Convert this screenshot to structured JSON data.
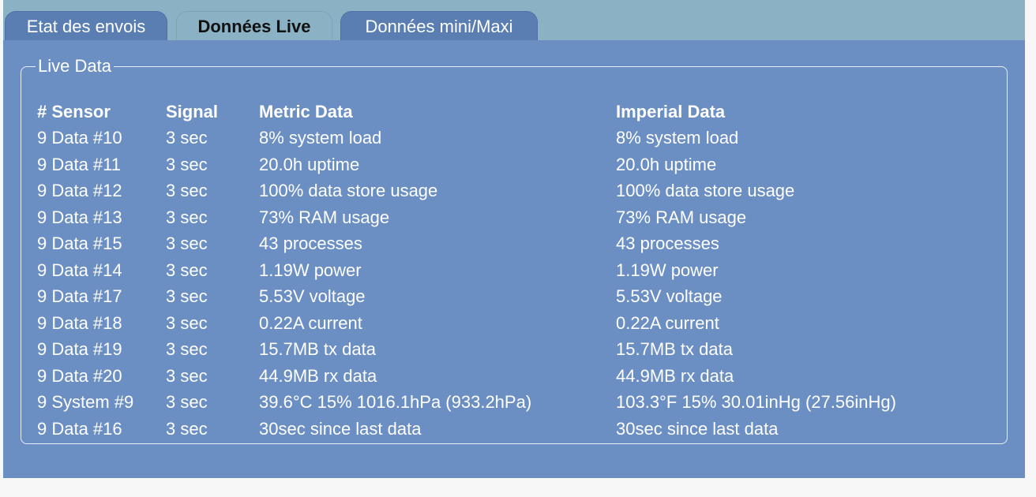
{
  "tabs": [
    {
      "label": "Etat des envois",
      "active": false
    },
    {
      "label": "Données Live",
      "active": true
    },
    {
      "label": "Données mini/Maxi",
      "active": false
    }
  ],
  "panel": {
    "legend": "Live Data",
    "headers": [
      "# Sensor",
      "Signal",
      "Metric Data",
      "Imperial Data"
    ],
    "rows": [
      [
        "9 Data #10",
        "3 sec",
        "8% system load",
        "8% system load"
      ],
      [
        "9 Data #11",
        "3 sec",
        "20.0h uptime",
        "20.0h uptime"
      ],
      [
        "9 Data #12",
        "3 sec",
        "100% data store usage",
        "100% data store usage"
      ],
      [
        "9 Data #13",
        "3 sec",
        "73% RAM usage",
        "73% RAM usage"
      ],
      [
        "9 Data #15",
        "3 sec",
        "43 processes",
        "43 processes"
      ],
      [
        "9 Data #14",
        "3 sec",
        "1.19W power",
        "1.19W power"
      ],
      [
        "9 Data #17",
        "3 sec",
        "5.53V voltage",
        "5.53V voltage"
      ],
      [
        "9 Data #18",
        "3 sec",
        "0.22A current",
        "0.22A current"
      ],
      [
        "9 Data #19",
        "3 sec",
        "15.7MB tx data",
        "15.7MB tx data"
      ],
      [
        "9 Data #20",
        "3 sec",
        "44.9MB rx data",
        "44.9MB rx data"
      ],
      [
        "9 System #9",
        "3 sec",
        "39.6°C 15% 1016.1hPa (933.2hPa)",
        "103.3°F 15% 30.01inHg (27.56inHg)"
      ],
      [
        "9 Data #16",
        "3 sec",
        "30sec since last data",
        "30sec since last data"
      ]
    ]
  },
  "colors": {
    "tabbar_bg": "#8ab2c4",
    "tab_inactive_bg": "#5a7eb2",
    "panel_bg": "#6b8fc3",
    "text": "#ffffff"
  }
}
